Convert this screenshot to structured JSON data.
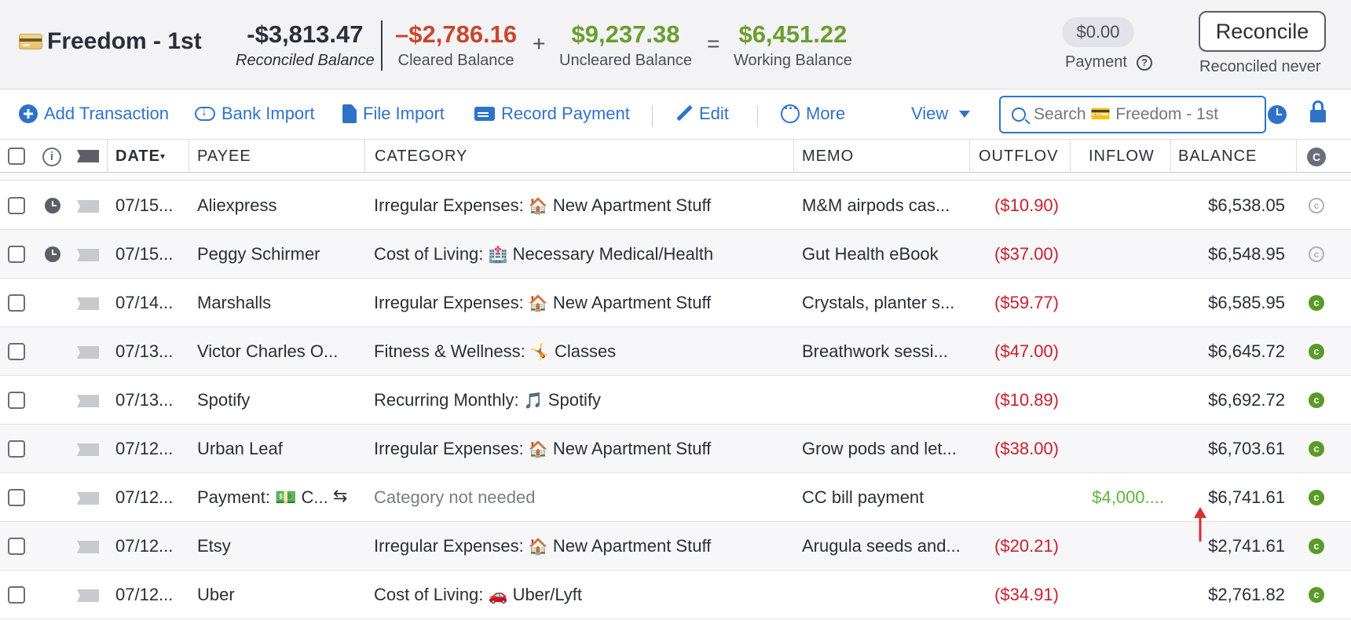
{
  "header": {
    "account_name": "Freedom - 1st",
    "account_icon": "credit-card-icon",
    "reconciled_balance": "-$3,813.47",
    "reconciled_label": "Reconciled Balance",
    "cleared_balance": "–$2,786.16",
    "cleared_label": "Cleared Balance",
    "plus": "+",
    "uncleared_balance": "$9,237.38",
    "uncleared_label": "Uncleared Balance",
    "equals": "=",
    "working_balance": "$6,451.22",
    "working_label": "Working Balance",
    "payment_amount": "$0.00",
    "payment_label": "Payment",
    "reconcile_button": "Reconcile",
    "reconciled_status": "Reconciled never",
    "colors": {
      "negative": "#c8472c",
      "positive": "#6a9e2e"
    }
  },
  "toolbar": {
    "add_transaction": "Add Transaction",
    "bank_import": "Bank Import",
    "file_import": "File Import",
    "record_payment": "Record Payment",
    "edit": "Edit",
    "more": "More",
    "view": "View",
    "search_placeholder": "Search 💳 Freedom - 1st",
    "accent": "#2f73c9"
  },
  "table": {
    "headers": {
      "date": "DATE",
      "payee": "PAYEE",
      "category": "CATEGORY",
      "memo": "MEMO",
      "outflow": "OUTFLOV",
      "inflow": "INFLOW",
      "balance": "BALANCE",
      "cleared": "C"
    },
    "rows": [
      {
        "date": "07/15...",
        "payee": "Aliexpress",
        "cat_group": "Irregular Expenses:",
        "cat_emoji": "🏠",
        "cat_name": "New Apartment Stuff",
        "memo": "M&M airpods cas...",
        "outflow": "($10.90)",
        "inflow": "",
        "balance": "$6,538.05",
        "scheduled": true,
        "cleared": false
      },
      {
        "date": "07/15...",
        "payee": "Peggy Schirmer",
        "cat_group": "Cost of Living:",
        "cat_emoji": "🏥",
        "cat_name": "Necessary Medical/Health",
        "memo": "Gut Health eBook",
        "outflow": "($37.00)",
        "inflow": "",
        "balance": "$6,548.95",
        "scheduled": true,
        "cleared": false
      },
      {
        "date": "07/14...",
        "payee": "Marshalls",
        "cat_group": "Irregular Expenses:",
        "cat_emoji": "🏠",
        "cat_name": "New Apartment Stuff",
        "memo": "Crystals, planter s...",
        "outflow": "($59.77)",
        "inflow": "",
        "balance": "$6,585.95",
        "scheduled": false,
        "cleared": true
      },
      {
        "date": "07/13...",
        "payee": "Victor Charles O...",
        "cat_group": "Fitness & Wellness:",
        "cat_emoji": "🤸",
        "cat_name": "Classes",
        "memo": "Breathwork sessi...",
        "outflow": "($47.00)",
        "inflow": "",
        "balance": "$6,645.72",
        "scheduled": false,
        "cleared": true
      },
      {
        "date": "07/13...",
        "payee": "Spotify",
        "cat_group": "Recurring Monthly:",
        "cat_emoji": "🎵",
        "cat_name": "Spotify",
        "memo": "",
        "outflow": "($10.89)",
        "inflow": "",
        "balance": "$6,692.72",
        "scheduled": false,
        "cleared": true
      },
      {
        "date": "07/12...",
        "payee": "Urban Leaf",
        "cat_group": "Irregular Expenses:",
        "cat_emoji": "🏠",
        "cat_name": "New Apartment Stuff",
        "memo": "Grow pods and let...",
        "outflow": "($38.00)",
        "inflow": "",
        "balance": "$6,703.61",
        "scheduled": false,
        "cleared": true
      },
      {
        "date": "07/12...",
        "payee": "Payment: 💵 C...",
        "cat_group": "Category not needed",
        "cat_emoji": "",
        "cat_name": "",
        "memo": "CC bill payment",
        "outflow": "",
        "inflow": "$4,000....",
        "balance": "$6,741.61",
        "scheduled": false,
        "cleared": true,
        "transfer": "⇆"
      },
      {
        "date": "07/12...",
        "payee": "Etsy",
        "cat_group": "Irregular Expenses:",
        "cat_emoji": "🏠",
        "cat_name": "New Apartment Stuff",
        "memo": "Arugula seeds and...",
        "outflow": "($20.21)",
        "inflow": "",
        "balance": "$2,741.61",
        "scheduled": false,
        "cleared": true
      },
      {
        "date": "07/12...",
        "payee": "Uber",
        "cat_group": "Cost of Living:",
        "cat_emoji": "🚗",
        "cat_name": "Uber/Lyft",
        "memo": "",
        "outflow": "($34.91)",
        "inflow": "",
        "balance": "$2,761.82",
        "scheduled": false,
        "cleared": true
      }
    ]
  }
}
